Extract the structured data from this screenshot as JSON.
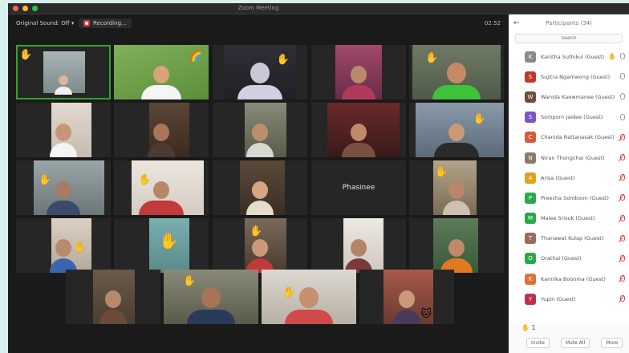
{
  "window": {
    "title": "Zoom Meeting"
  },
  "toolbar": {
    "audio_label": "Original Sound: Off",
    "recording_label": "Recording...",
    "timer": "02:52"
  },
  "center_tile_name": "Phasinee",
  "participants_panel": {
    "title": "Participants (34)",
    "search_placeholder": "Search",
    "participants": [
      {
        "name": "Kanitha Suthikul (Guest)",
        "avatar_color": "#8a8a8a",
        "avatar_letter": "K",
        "hand": true,
        "mic": "on"
      },
      {
        "name": "Sujitra Ngamwong (Guest)",
        "avatar_color": "#c0392b",
        "avatar_letter": "S",
        "hand": false,
        "mic": "on"
      },
      {
        "name": "Wanida Kaewmanee (Guest)",
        "avatar_color": "#6b4e3d",
        "avatar_letter": "W",
        "hand": false,
        "mic": "on"
      },
      {
        "name": "Somporn Jaidee (Guest)",
        "avatar_color": "#7a55c6",
        "avatar_letter": "S",
        "hand": false,
        "mic": "on"
      },
      {
        "name": "Chanida Rattanasak (Guest)",
        "avatar_color": "#d35a3a",
        "avatar_letter": "C",
        "hand": false,
        "mic": "muted"
      },
      {
        "name": "Niran Thongchai (Guest)",
        "avatar_color": "#8a7a6a",
        "avatar_letter": "N",
        "hand": false,
        "mic": "muted"
      },
      {
        "name": "Arisa (Guest)",
        "avatar_color": "#e0a020",
        "avatar_letter": "A",
        "hand": false,
        "mic": "muted"
      },
      {
        "name": "Preecha Somboon (Guest)",
        "avatar_color": "#2ba84a",
        "avatar_letter": "P",
        "hand": false,
        "mic": "muted"
      },
      {
        "name": "Malee Srisuk (Guest)",
        "avatar_color": "#2ba84a",
        "avatar_letter": "M",
        "hand": false,
        "mic": "muted"
      },
      {
        "name": "Thanawat Kulap (Guest)",
        "avatar_color": "#9a6a5a",
        "avatar_letter": "T",
        "hand": false,
        "mic": "muted"
      },
      {
        "name": "Orathai (Guest)",
        "avatar_color": "#2ba84a",
        "avatar_letter": "O",
        "hand": false,
        "mic": "muted"
      },
      {
        "name": "Kannika Boonma (Guest)",
        "avatar_color": "#e0703a",
        "avatar_letter": "K",
        "hand": false,
        "mic": "muted"
      },
      {
        "name": "Yupin (Guest)",
        "avatar_color": "#c0304a",
        "avatar_letter": "Y",
        "hand": false,
        "mic": "muted"
      }
    ],
    "footer": {
      "raised_count": "1",
      "invite_label": "Invite",
      "mute_all_label": "Mute All",
      "more_label": "More"
    }
  },
  "colors": {
    "active_speaker_border": "#2fa52f",
    "muted_mic": "#e0453b",
    "page_background": "#d9f1ee"
  }
}
